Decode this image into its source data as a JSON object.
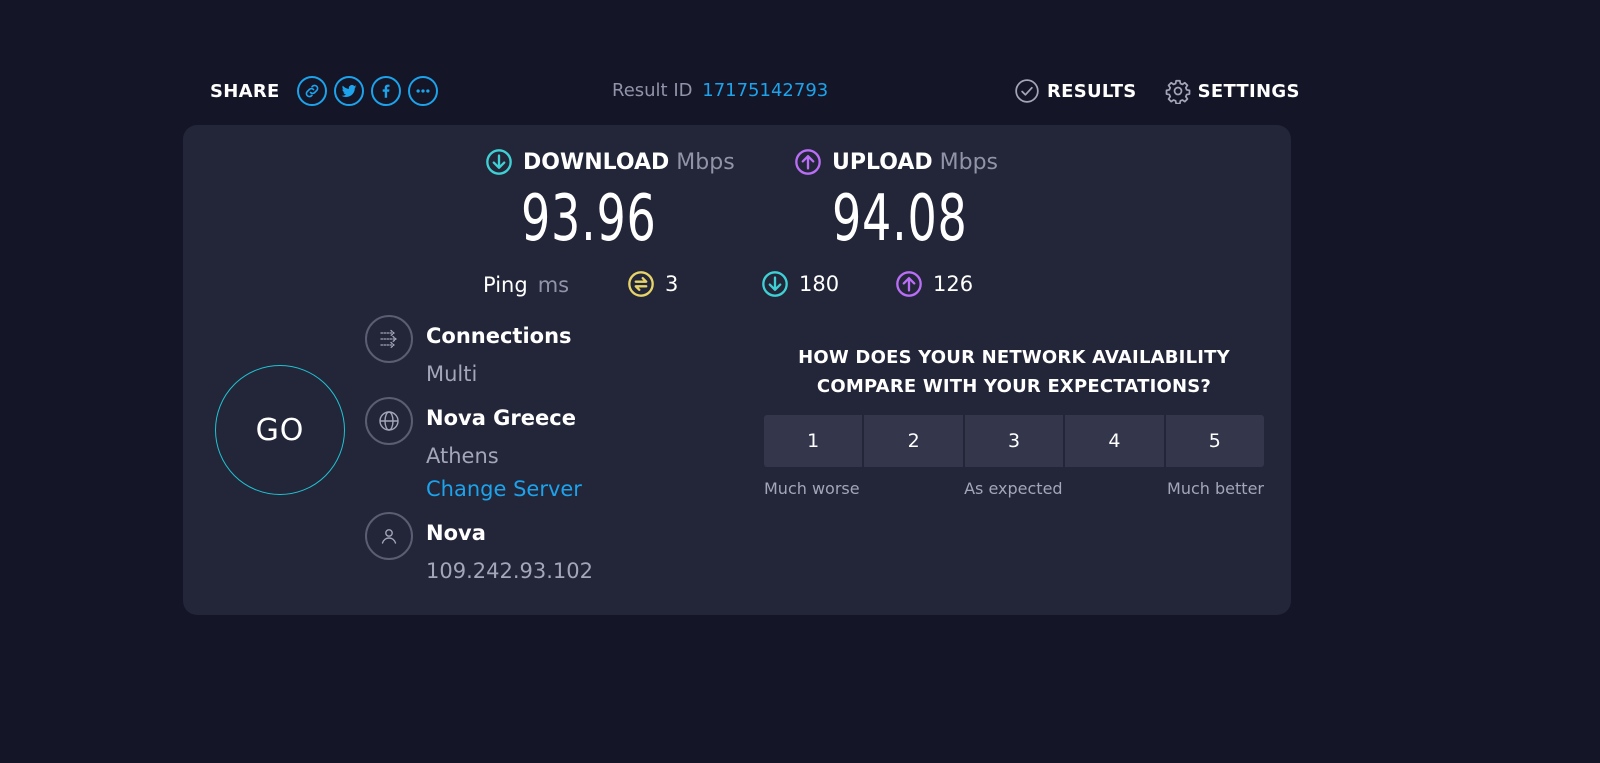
{
  "share": {
    "label": "SHARE",
    "buttons": [
      "link-icon",
      "twitter-icon",
      "facebook-icon",
      "more-icon"
    ]
  },
  "result": {
    "label": "Result ID",
    "id": "17175142793"
  },
  "nav": {
    "results": "RESULTS",
    "settings": "SETTINGS"
  },
  "download": {
    "label": "DOWNLOAD",
    "unit": "Mbps",
    "value": "93.96"
  },
  "upload": {
    "label": "UPLOAD",
    "unit": "Mbps",
    "value": "94.08"
  },
  "ping": {
    "label": "Ping",
    "unit": "ms",
    "idle": "3",
    "download": "180",
    "upload": "126"
  },
  "go": {
    "label": "GO"
  },
  "connections": {
    "title": "Connections",
    "value": "Multi"
  },
  "server": {
    "title": "Nova Greece",
    "location": "Athens",
    "change": "Change Server"
  },
  "provider": {
    "title": "Nova",
    "ip": "109.242.93.102"
  },
  "survey": {
    "question_line1": "HOW DOES YOUR NETWORK AVAILABILITY",
    "question_line2": "COMPARE WITH YOUR EXPECTATIONS?",
    "ratings": [
      "1",
      "2",
      "3",
      "4",
      "5"
    ],
    "low": "Much worse",
    "mid": "As expected",
    "high": "Much better"
  },
  "colors": {
    "background": "#141526",
    "card": "#232538",
    "accent": "#1ca3ec",
    "download": "#3fd0d4",
    "upload": "#b86ef5",
    "idle": "#e6d36a"
  }
}
